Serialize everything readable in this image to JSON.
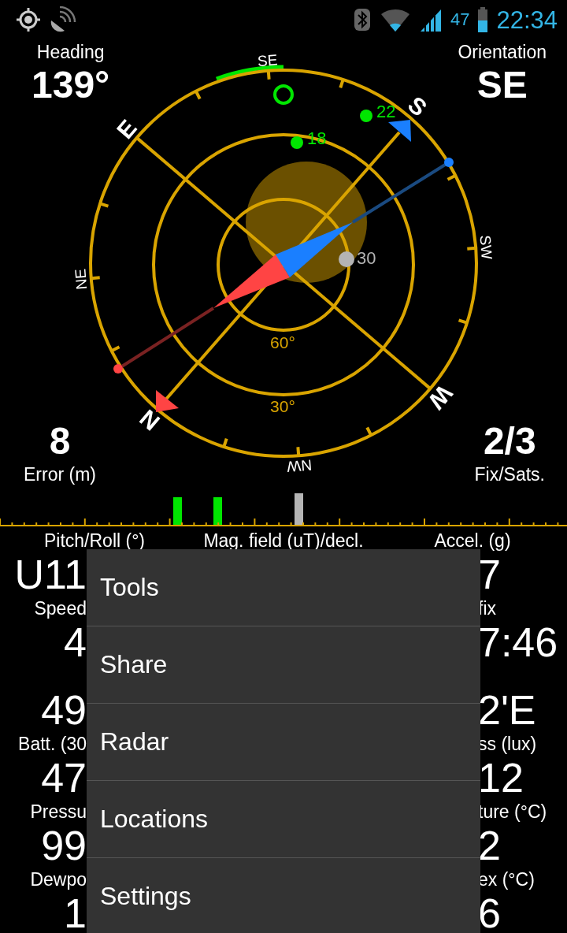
{
  "status_bar": {
    "battery_percent": "47",
    "time": "22:34"
  },
  "heading": {
    "label": "Heading",
    "value": "139°"
  },
  "orientation": {
    "label": "Orientation",
    "value": "SE"
  },
  "error": {
    "label": "Error (m)",
    "value": "8"
  },
  "fix": {
    "label": "Fix/Sats.",
    "value": "2/3"
  },
  "compass": {
    "direction_labels": [
      {
        "text": "SE",
        "kind": "minor"
      },
      {
        "text": "S",
        "kind": "major"
      },
      {
        "text": "SW",
        "kind": "minor"
      },
      {
        "text": "W",
        "kind": "major"
      },
      {
        "text": "NW",
        "kind": "minor"
      },
      {
        "text": "N",
        "kind": "major"
      },
      {
        "text": "NE",
        "kind": "minor"
      },
      {
        "text": "E",
        "kind": "major"
      }
    ],
    "elevation_labels": [
      "60°",
      "30°"
    ],
    "satellites": [
      {
        "id": "18",
        "color": "#00e600"
      },
      {
        "id": "22",
        "color": "#00e600"
      },
      {
        "id": "30",
        "color": "#b4b4b4"
      }
    ]
  },
  "data_grid": {
    "header_labels": [
      "Pitch/Roll (°)",
      "Mag. field (uT)/decl.",
      "Accel. (g)"
    ],
    "rows": [
      {
        "left": {
          "value": "U11"
        },
        "right": {
          "value": "7"
        }
      },
      {
        "left": {
          "label": "Speed",
          "value": "4"
        },
        "right": {
          "label": "fix",
          "value": "7:46"
        }
      },
      {
        "left": {
          "value": "49"
        },
        "right": {
          "value": "2'E"
        }
      },
      {
        "left": {
          "label": "Batt. (30",
          "value": "47"
        },
        "right": {
          "label": "ss (lux)",
          "value": "12"
        }
      },
      {
        "left": {
          "label": "Pressu",
          "value": "99"
        },
        "right": {
          "label": "ture (°C)",
          "value": "2"
        }
      },
      {
        "left": {
          "label": "Dewpo",
          "value": "1"
        },
        "right": {
          "label": "ex (°C)",
          "value": "6"
        }
      }
    ]
  },
  "menu": {
    "items": [
      "Tools",
      "Share",
      "Radar",
      "Locations",
      "Settings"
    ]
  }
}
